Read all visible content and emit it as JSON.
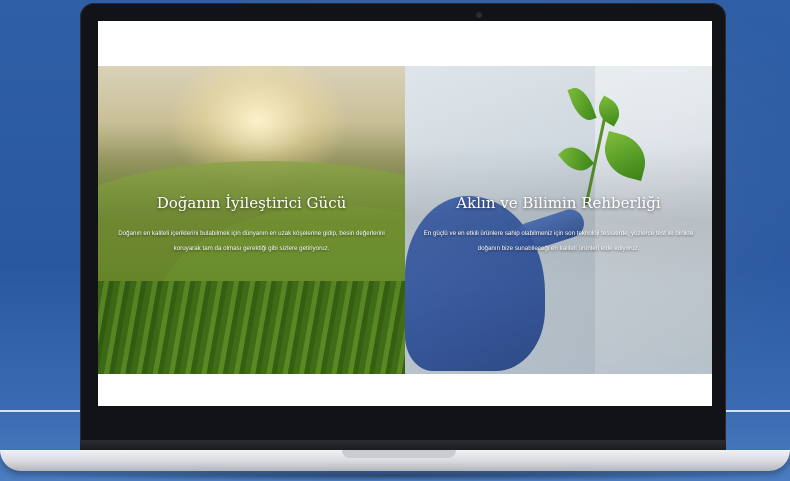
{
  "website": {
    "left_panel": {
      "title": "Doğanın İyileştirici Gücü",
      "body": "Doğanın en kaliteli içeriklerini bulabilmek için dünyanın en uzak köşelerine gidip, besin değerlerini koruyarak tam da olması gerektiği gibi sizlere getiriyoruz."
    },
    "right_panel": {
      "title": "Aklın ve Bilimin Rehberliği",
      "body": "En güçlü ve en etkili ürünlere sahip olabilmeniz için son teknoloji tesislerde, yüzlerce test ile birlikte doğanın bize sunabileceği en kaliteli ürünleri elde ediyoruz."
    }
  },
  "colors": {
    "background": "#2f5fa6",
    "bezel": "#121316",
    "accent_green": "#5a8b25"
  }
}
